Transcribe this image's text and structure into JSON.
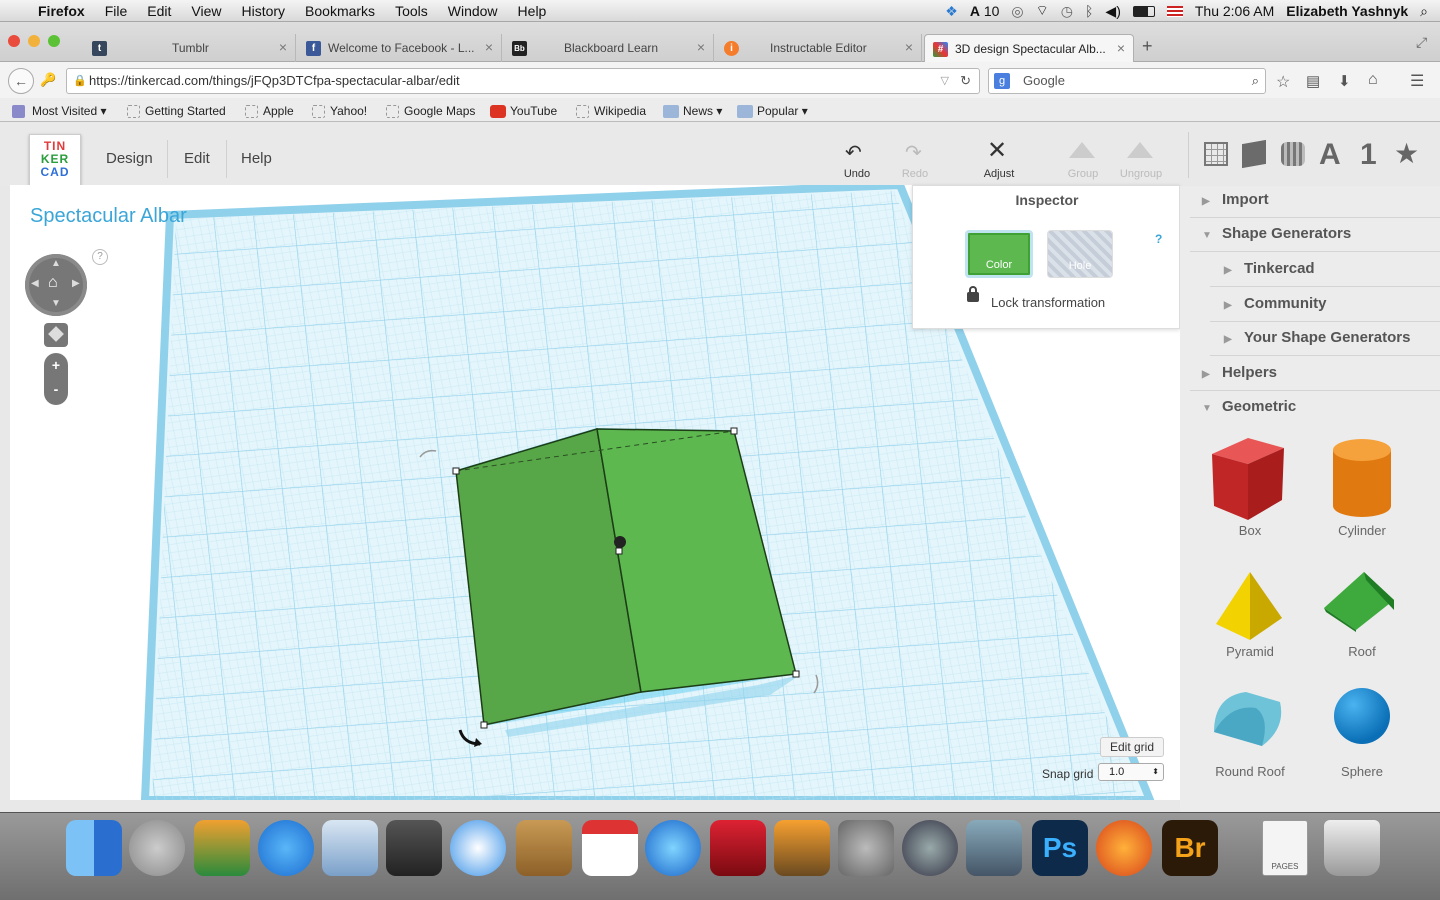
{
  "menubar": {
    "app": "Firefox",
    "items": [
      "File",
      "Edit",
      "View",
      "History",
      "Bookmarks",
      "Tools",
      "Window",
      "Help"
    ],
    "status_extra": "10",
    "clock": "Thu 2:06 AM",
    "user": "Elizabeth Yashnyk"
  },
  "tabs": [
    {
      "label": "Tumblr",
      "color": "#36465d",
      "glyph": "t"
    },
    {
      "label": "Welcome to Facebook - L...",
      "color": "#3b5998",
      "glyph": "f"
    },
    {
      "label": "Blackboard Learn",
      "color": "#222",
      "glyph": "Bb"
    },
    {
      "label": "Instructable Editor",
      "color": "#f57c2b",
      "glyph": "i"
    },
    {
      "label": "3D design Spectacular Alb...",
      "color": "#2a9d3c",
      "glyph": "#"
    }
  ],
  "url": "https://tinkercad.com/things/jFQp3DTCfpa-spectacular-albar/edit",
  "search_placeholder": "Google",
  "bookmarks": [
    "Most Visited",
    "Getting Started",
    "Apple",
    "Yahoo!",
    "Google Maps",
    "YouTube",
    "Wikipedia",
    "News",
    "Popular"
  ],
  "logo": [
    "TIN",
    "KER",
    "CAD"
  ],
  "topnav": [
    "Design",
    "Edit",
    "Help"
  ],
  "toolbar": {
    "undo": "Undo",
    "redo": "Redo",
    "adjust": "Adjust",
    "group": "Group",
    "ungroup": "Ungroup"
  },
  "view_icons": [
    "A",
    "1"
  ],
  "design_title": "Spectacular Albar",
  "help_q": "?",
  "zoom": {
    "plus": "+",
    "minus": "-"
  },
  "inspector": {
    "title": "Inspector",
    "color_label": "Color",
    "hole_label": "Hole",
    "help": "?",
    "lock_label": "Lock transformation",
    "shape_color": "#5cb84f"
  },
  "panel": {
    "import": "Import",
    "shape_generators": "Shape Generators",
    "tinkercad": "Tinkercad",
    "community": "Community",
    "your_generators": "Your Shape Generators",
    "helpers": "Helpers",
    "geometric": "Geometric",
    "shapes": [
      "Box",
      "Cylinder",
      "Pyramid",
      "Roof",
      "Round Roof",
      "Sphere"
    ]
  },
  "grid": {
    "edit_label": "Edit grid",
    "snap_label": "Snap grid",
    "snap_value": "1.0"
  },
  "dock_pages": "PAGES"
}
